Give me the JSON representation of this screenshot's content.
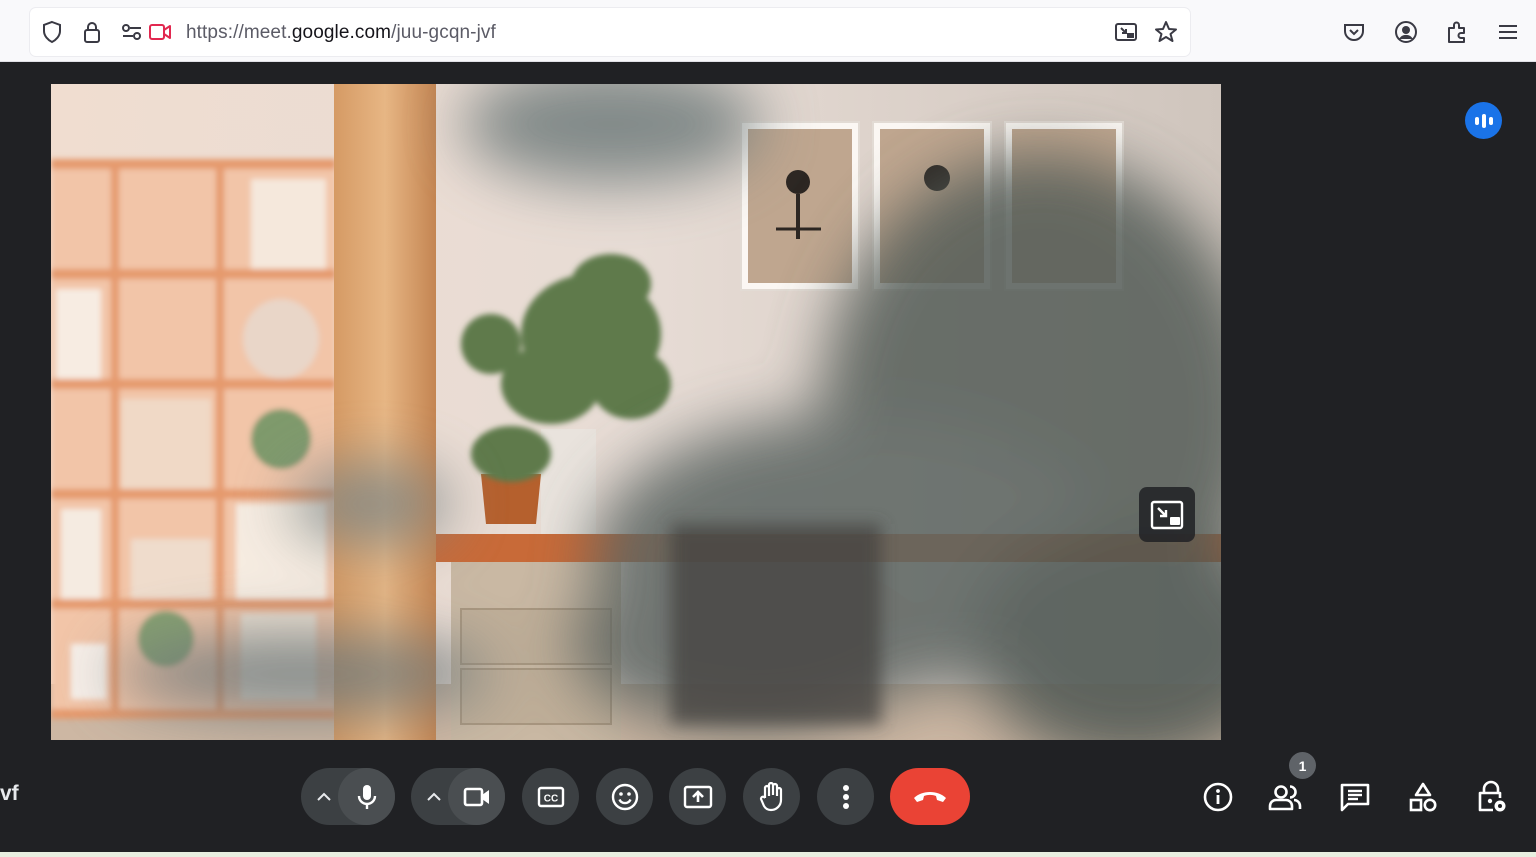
{
  "browser": {
    "url_prefix": "https://meet.",
    "url_host": "google.com",
    "url_path": "/juu-gcqn-jvf"
  },
  "meet": {
    "meeting_code_fragment": "vf",
    "participants_count": "1"
  },
  "colors": {
    "background": "#202124",
    "control_button": "#3c4043",
    "end_call": "#ea4335",
    "speaking_indicator": "#1a73e8"
  },
  "icons": {
    "toolbar": [
      "shield-icon",
      "lock-icon",
      "permissions-icon",
      "camera-sharing-icon",
      "pip-icon",
      "bookmark-star-icon",
      "pocket-icon",
      "account-icon",
      "extensions-icon",
      "menu-icon"
    ],
    "controls": [
      "mic-options-icon",
      "mic-icon",
      "camera-options-icon",
      "camera-icon",
      "captions-icon",
      "emoji-icon",
      "present-icon",
      "raise-hand-icon",
      "more-options-icon",
      "end-call-icon"
    ],
    "right_panel": [
      "info-icon",
      "people-icon",
      "chat-icon",
      "activities-icon",
      "host-controls-icon"
    ]
  }
}
